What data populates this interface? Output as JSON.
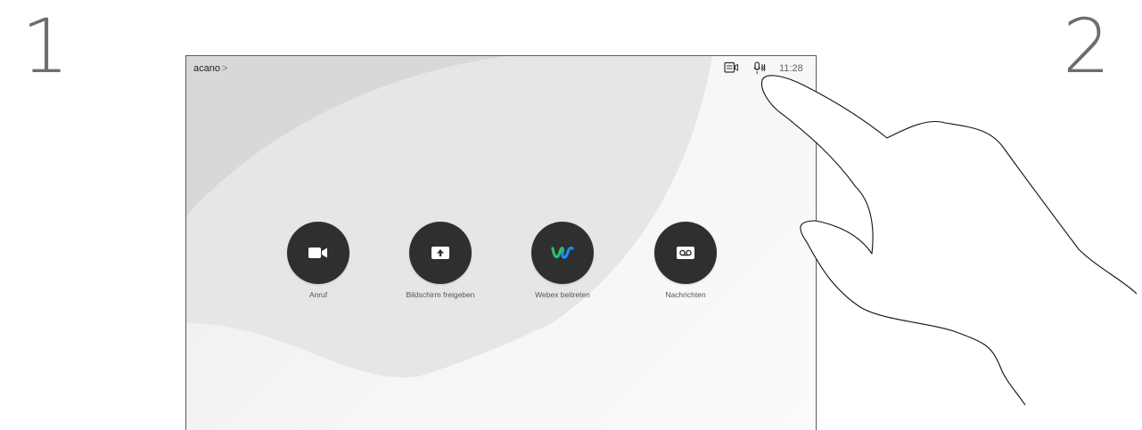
{
  "steps": {
    "first": "1",
    "second": "2"
  },
  "header": {
    "system_name": "acano",
    "system_name_chevron": ">",
    "time": "11:28",
    "icons": [
      "self-view-icon",
      "microphone-icon"
    ]
  },
  "actions": [
    {
      "label": "Anruf",
      "icon": "video-camera-icon"
    },
    {
      "label": "Bildschirm freigeben",
      "icon": "share-upload-icon"
    },
    {
      "label": "Webex beitreten",
      "icon": "webex-logo-icon"
    },
    {
      "label": "Nachrichten",
      "icon": "voicemail-icon"
    }
  ],
  "colors": {
    "button": "#2f2f2f",
    "webex_blue": "#1d8cf0",
    "webex_green": "#2bbd6e"
  }
}
